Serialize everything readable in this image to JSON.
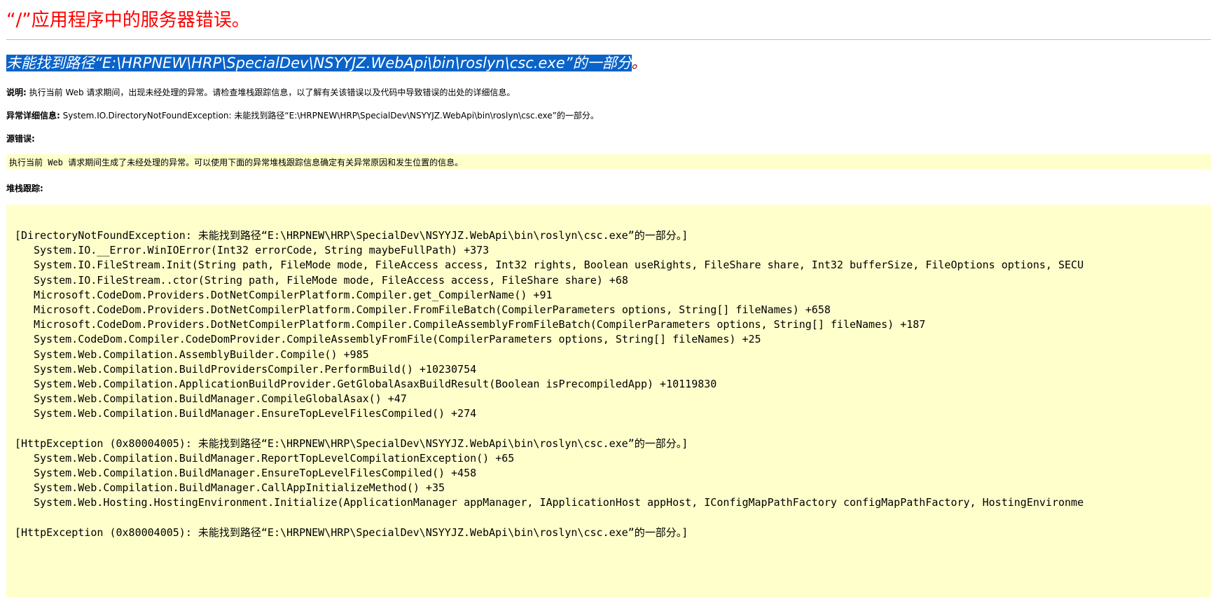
{
  "page": {
    "app_title": "“/”应用程序中的服务器错误。",
    "error_heading": "未能找到路径“E:\\HRPNEW\\HRP\\SpecialDev\\NSYYJZ.WebApi\\bin\\roslyn\\csc.exe”的一部分",
    "error_heading_suffix": "。"
  },
  "description": {
    "label": "说明:",
    "text": " 执行当前 Web 请求期间，出现未经处理的异常。请检查堆栈跟踪信息，以了解有关该错误以及代码中导致错误的出处的详细信息。"
  },
  "exception_details": {
    "label": "异常详细信息:",
    "text": " System.IO.DirectoryNotFoundException: 未能找到路径“E:\\HRPNEW\\HRP\\SpecialDev\\NSYYJZ.WebApi\\bin\\roslyn\\csc.exe”的一部分。"
  },
  "source_error": {
    "label": "源错误:",
    "text": "执行当前 Web 请求期间生成了未经处理的异常。可以使用下面的异常堆栈跟踪信息确定有关异常原因和发生位置的信息。"
  },
  "stack_trace": {
    "label": "堆栈跟踪:",
    "lines": [
      {
        "kind": "header",
        "text": "[DirectoryNotFoundException: 未能找到路径“E:\\HRPNEW\\HRP\\SpecialDev\\NSYYJZ.WebApi\\bin\\roslyn\\csc.exe”的一部分。]"
      },
      {
        "kind": "frame",
        "text": "System.IO.__Error.WinIOError(Int32 errorCode, String maybeFullPath) +373"
      },
      {
        "kind": "frame",
        "text": "System.IO.FileStream.Init(String path, FileMode mode, FileAccess access, Int32 rights, Boolean useRights, FileShare share, Int32 bufferSize, FileOptions options, SECU"
      },
      {
        "kind": "frame",
        "text": "System.IO.FileStream..ctor(String path, FileMode mode, FileAccess access, FileShare share) +68"
      },
      {
        "kind": "frame",
        "text": "Microsoft.CodeDom.Providers.DotNetCompilerPlatform.Compiler.get_CompilerName() +91"
      },
      {
        "kind": "frame",
        "text": "Microsoft.CodeDom.Providers.DotNetCompilerPlatform.Compiler.FromFileBatch(CompilerParameters options, String[] fileNames) +658"
      },
      {
        "kind": "frame",
        "text": "Microsoft.CodeDom.Providers.DotNetCompilerPlatform.Compiler.CompileAssemblyFromFileBatch(CompilerParameters options, String[] fileNames) +187"
      },
      {
        "kind": "frame",
        "text": "System.CodeDom.Compiler.CodeDomProvider.CompileAssemblyFromFile(CompilerParameters options, String[] fileNames) +25"
      },
      {
        "kind": "frame",
        "text": "System.Web.Compilation.AssemblyBuilder.Compile() +985"
      },
      {
        "kind": "frame",
        "text": "System.Web.Compilation.BuildProvidersCompiler.PerformBuild() +10230754"
      },
      {
        "kind": "frame",
        "text": "System.Web.Compilation.ApplicationBuildProvider.GetGlobalAsaxBuildResult(Boolean isPrecompiledApp) +10119830"
      },
      {
        "kind": "frame",
        "text": "System.Web.Compilation.BuildManager.CompileGlobalAsax() +47"
      },
      {
        "kind": "frame",
        "text": "System.Web.Compilation.BuildManager.EnsureTopLevelFilesCompiled() +274"
      },
      {
        "kind": "blank",
        "text": ""
      },
      {
        "kind": "header",
        "text": "[HttpException (0x80004005): 未能找到路径“E:\\HRPNEW\\HRP\\SpecialDev\\NSYYJZ.WebApi\\bin\\roslyn\\csc.exe”的一部分。]"
      },
      {
        "kind": "frame",
        "text": "System.Web.Compilation.BuildManager.ReportTopLevelCompilationException() +65"
      },
      {
        "kind": "frame",
        "text": "System.Web.Compilation.BuildManager.EnsureTopLevelFilesCompiled() +458"
      },
      {
        "kind": "frame",
        "text": "System.Web.Compilation.BuildManager.CallAppInitializeMethod() +35"
      },
      {
        "kind": "frame",
        "text": "System.Web.Hosting.HostingEnvironment.Initialize(ApplicationManager appManager, IApplicationHost appHost, IConfigMapPathFactory configMapPathFactory, HostingEnvironme"
      },
      {
        "kind": "blank",
        "text": ""
      },
      {
        "kind": "header",
        "text": "[HttpException (0x80004005): 未能找到路径“E:\\HRPNEW\\HRP\\SpecialDev\\NSYYJZ.WebApi\\bin\\roslyn\\csc.exe”的一部分。]"
      }
    ]
  },
  "colors": {
    "title_red": "#ff0000",
    "heading_maroon": "#800000",
    "selection_blue": "#0a63c9",
    "code_background": "#ffffcc"
  }
}
